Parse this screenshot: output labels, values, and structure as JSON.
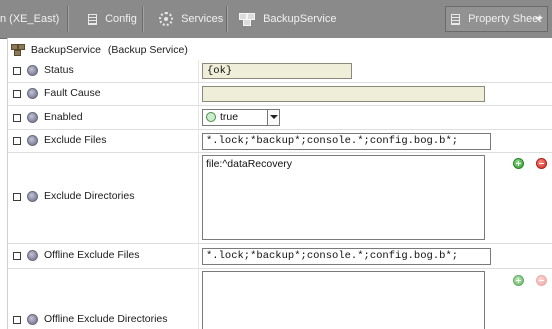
{
  "nav": {
    "items": [
      {
        "label": "n (XE_East)",
        "icon": "station-icon"
      },
      {
        "label": "Config",
        "icon": "document-icon"
      },
      {
        "label": "Services",
        "icon": "gear-icon"
      },
      {
        "label": "BackupService",
        "icon": "service-icon"
      }
    ],
    "view_selector": {
      "label": "Property Sheet",
      "icon": "document-icon"
    }
  },
  "sheet": {
    "header": {
      "name": "BackupService",
      "type": "(Backup Service)"
    },
    "rows": [
      {
        "label": "Status",
        "value": "{ok}",
        "kind": "readonly-text"
      },
      {
        "label": "Fault Cause",
        "value": "",
        "kind": "readonly-text"
      },
      {
        "label": "Enabled",
        "value": "true",
        "kind": "boolean-dropdown"
      },
      {
        "label": "Exclude Files",
        "value": "*.lock;*backup*;console.*;config.bog.b*;",
        "kind": "text"
      },
      {
        "label": "Exclude Directories",
        "value": "file:^dataRecovery",
        "kind": "list"
      },
      {
        "label": "Offline Exclude Files",
        "value": "*.lock;*backup*;console.*;config.bog.b*;",
        "kind": "text"
      },
      {
        "label": "Offline Exclude Directories",
        "value": "",
        "kind": "list"
      }
    ]
  },
  "colors": {
    "nav_bg": "#8a8a8a",
    "readonly_field_bg": "#efeed8",
    "add_button": "#2f9a2f",
    "remove_button": "#d02a20"
  }
}
